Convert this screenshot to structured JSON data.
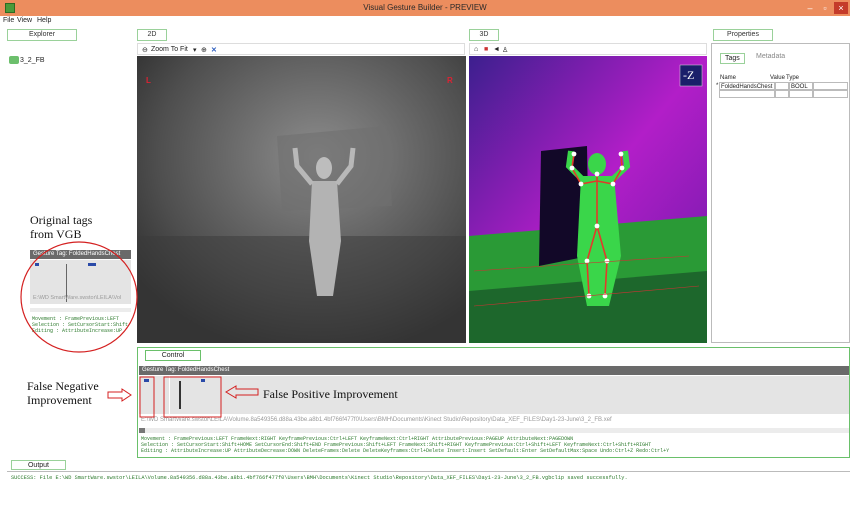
{
  "window": {
    "title": "Visual Gesture Builder - PREVIEW",
    "minimize": "–",
    "restore": "▫",
    "close": "×"
  },
  "menu": [
    "File",
    "View",
    "Help"
  ],
  "panels": {
    "explorer": "Explorer",
    "view2d": "2D",
    "view3d": "3D",
    "properties": "Properties",
    "control": "Control",
    "output": "Output"
  },
  "explorer": {
    "item": "3_2_FB"
  },
  "toolbar2d": {
    "zoom": "Zoom To Fit"
  },
  "view2d": {
    "left_marker": "L",
    "right_marker": "R"
  },
  "view3d": {
    "axis_label": "-Z"
  },
  "properties": {
    "tabs": [
      "Tags",
      "Metadata"
    ],
    "columns": [
      "Name",
      "Value",
      "Type"
    ],
    "rows": [
      {
        "marker": "*",
        "name": "FoldedHandsChest",
        "value": "",
        "type": "BOOL"
      }
    ]
  },
  "control": {
    "gesture_tag": "Gesture Tag: FoldedHandsChest",
    "path": "E:\\WD SmartWare.swstor\\LEILA\\Volume.8a549356.d88a.43be.a8b1.4bf766f477f0\\Users\\BMH\\Documents\\Kinect Studio\\Repository\\Data_XEF_FILES\\Day1-23-June\\3_2_FB.xef",
    "help": [
      "Movement  :  FramePrevious:LEFT FrameNext:RIGHT KeyframePrevious:Ctrl+LEFT KeyframeNext:Ctrl+RIGHT AttributePrevious:PAGEUP AttributeNext:PAGEDOWN",
      "Selection :  SetCursorStart:Shift+HOME SetCursorEnd:Shift+END FramePrevious:Shift+LEFT FrameNext:Shift+RIGHT KeyframePrevious:Ctrl+Shift+LEFT KeyframeNext:Ctrl+Shift+RIGHT",
      "Editing   :  AttributeIncrease:UP AttributeDecrease:DOWN DeleteFrames:Delete DeleteKeyframes:Ctrl+Delete Insert:Insert SetDefault:Enter SetDefaultMax:Space Undo:Ctrl+Z Redo:Ctrl+Y"
    ]
  },
  "mini_inset": {
    "gesture_tag": "Gesture Tag: FoldedHandsChest",
    "path": "E:\\WD SmartWare.swstor\\LEILA\\Vol",
    "help": [
      "Movement  :  FramePrevious:LEFT",
      "Selection :  SetCursorStart:Shift",
      "Editing   :  AttributeIncrease:UP"
    ]
  },
  "output": {
    "text": "SUCCESS: File E:\\WD SmartWare.swstor\\LEILA\\Volume.8a549356.d88a.43be.a8b1.4bf766f477f0\\Users\\BMH\\Documents\\Kinect Studio\\Repository\\Data_XEF_FILES\\Day1-23-June\\3_2_FB.vgbclip saved successfully."
  },
  "annotations": {
    "original_tags": [
      "Original tags",
      "from VGB"
    ],
    "false_negative": [
      "False Negative",
      "Improvement"
    ],
    "false_positive": "False Positive Improvement"
  },
  "colors": {
    "titlebar": "#ec8d5e",
    "panel_border": "#8ccf8c",
    "help_text": "#2c7a2c",
    "annotation_red": "#d42020"
  }
}
